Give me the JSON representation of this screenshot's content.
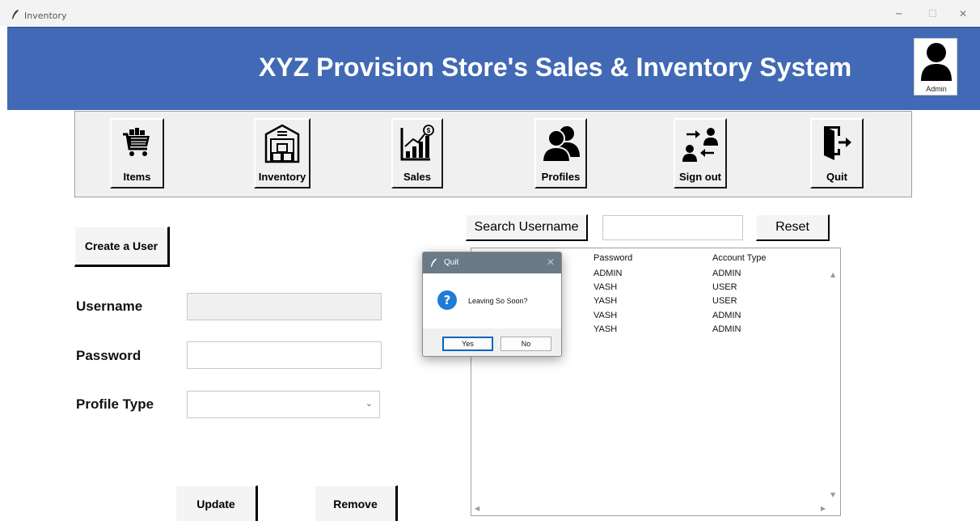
{
  "window": {
    "title": "Inventory",
    "minimize": "─",
    "maximize": "☐",
    "close": "✕"
  },
  "header": {
    "title": "XYZ Provision Store's Sales & Inventory System",
    "user_label": "Admin"
  },
  "nav": {
    "items": [
      {
        "label": "Items",
        "icon": "shopping-cart-icon"
      },
      {
        "label": "Inventory",
        "icon": "warehouse-icon"
      },
      {
        "label": "Sales",
        "icon": "sales-chart-icon"
      },
      {
        "label": "Profiles",
        "icon": "profiles-icon"
      },
      {
        "label": "Sign out",
        "icon": "switch-user-icon"
      },
      {
        "label": "Quit",
        "icon": "exit-door-icon"
      }
    ]
  },
  "form": {
    "create_user_label": "Create a User",
    "username_label": "Username",
    "username_value": "",
    "password_label": "Password",
    "password_value": "",
    "profile_type_label": "Profile Type",
    "profile_type_value": "",
    "update_label": "Update",
    "remove_label": "Remove"
  },
  "search": {
    "button_label": "Search Username",
    "value": "",
    "reset_label": "Reset"
  },
  "table": {
    "columns": [
      "Password",
      "Account Type"
    ],
    "rows": [
      [
        "ADMIN",
        "ADMIN"
      ],
      [
        "VASH",
        "USER"
      ],
      [
        "YASH",
        "USER"
      ],
      [
        "VASH",
        "ADMIN"
      ],
      [
        "YASH",
        "ADMIN"
      ]
    ]
  },
  "dialog": {
    "title": "Quit",
    "message": "Leaving So Soon?",
    "yes_label": "Yes",
    "no_label": "No",
    "icon": "question-icon",
    "accent": "#1f7bd6"
  },
  "colors": {
    "header": "#4169b5",
    "dialog_title": "#6a7a87"
  }
}
